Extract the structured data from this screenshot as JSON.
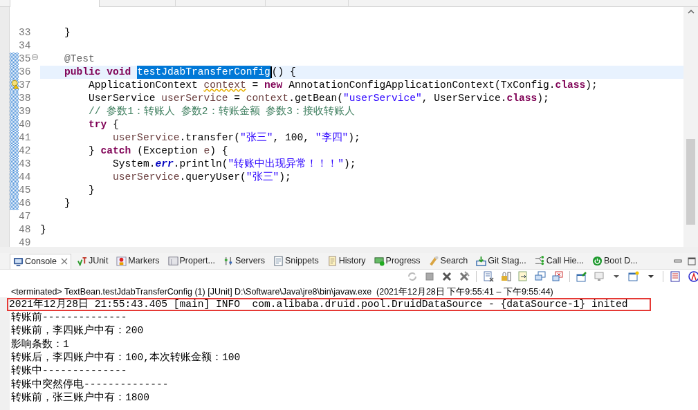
{
  "editor": {
    "lines": [
      {
        "number": "33",
        "changed": false,
        "current": false,
        "collapsible": false,
        "has_warning": false,
        "tokens": [
          {
            "kind": "plain",
            "text": "    }"
          }
        ]
      },
      {
        "number": "34",
        "changed": false,
        "current": false,
        "collapsible": false,
        "has_warning": false
      },
      {
        "number": "35",
        "changed": true,
        "current": false,
        "collapsible": true,
        "has_warning": false,
        "tokens": [
          {
            "kind": "annotation",
            "text": "    @Test"
          }
        ]
      },
      {
        "number": "36",
        "changed": true,
        "current": true,
        "collapsible": false,
        "has_warning": false,
        "tokens": [
          {
            "kind": "keyword",
            "text": "    public"
          },
          {
            "kind": "keyword",
            "text": " void"
          },
          {
            "kind": "selection",
            "text": " testJdabTransferConfig"
          },
          {
            "kind": "plain",
            "text": "() {"
          }
        ]
      },
      {
        "number": "37",
        "changed": true,
        "current": false,
        "collapsible": false,
        "has_warning": true,
        "tokens": [
          {
            "kind": "plain",
            "text": "        ApplicationContext"
          },
          {
            "kind": "warning",
            "text": " context"
          },
          {
            "kind": "plain",
            "text": " = "
          },
          {
            "kind": "keyword",
            "text": "new"
          },
          {
            "kind": "plain",
            "text": " AnnotationConfigApplicationContext(TxConfig."
          },
          {
            "kind": "keyword",
            "text": "class"
          },
          {
            "kind": "plain",
            "text": ");"
          }
        ]
      },
      {
        "number": "38",
        "changed": true,
        "current": false,
        "collapsible": false,
        "has_warning": false,
        "tokens": [
          {
            "kind": "plain",
            "text": "        UserService"
          },
          {
            "kind": "local",
            "text": " userService"
          },
          {
            "kind": "plain",
            "text": " = "
          },
          {
            "kind": "local",
            "text": "context"
          },
          {
            "kind": "plain",
            "text": ".getBean("
          },
          {
            "kind": "string",
            "text": "\"userService\""
          },
          {
            "kind": "plain",
            "text": ", UserService."
          },
          {
            "kind": "keyword",
            "text": "class"
          },
          {
            "kind": "plain",
            "text": ");"
          }
        ]
      },
      {
        "number": "39",
        "changed": true,
        "current": false,
        "collapsible": false,
        "has_warning": false,
        "tokens": [
          {
            "kind": "comment",
            "text": "        // 参数1：转账人 参数2：转账金额 参数3：接收转账人"
          }
        ]
      },
      {
        "number": "40",
        "changed": true,
        "current": false,
        "collapsible": false,
        "has_warning": false,
        "tokens": [
          {
            "kind": "keyword",
            "text": "        try"
          },
          {
            "kind": "plain",
            "text": " {"
          }
        ]
      },
      {
        "number": "41",
        "changed": true,
        "current": false,
        "collapsible": false,
        "has_warning": false,
        "tokens": [
          {
            "kind": "local",
            "text": "            userService"
          },
          {
            "kind": "plain",
            "text": ".transfer("
          },
          {
            "kind": "string",
            "text": "\"张三\""
          },
          {
            "kind": "plain",
            "text": ", 100, "
          },
          {
            "kind": "string",
            "text": "\"李四\""
          },
          {
            "kind": "plain",
            "text": ");"
          }
        ]
      },
      {
        "number": "42",
        "changed": true,
        "current": false,
        "collapsible": false,
        "has_warning": false,
        "tokens": [
          {
            "kind": "plain",
            "text": "        }"
          },
          {
            "kind": "keyword",
            "text": " catch"
          },
          {
            "kind": "plain",
            "text": " (Exception"
          },
          {
            "kind": "local",
            "text": " e"
          },
          {
            "kind": "plain",
            "text": ") {"
          }
        ]
      },
      {
        "number": "43",
        "changed": true,
        "current": false,
        "collapsible": false,
        "has_warning": false,
        "tokens": [
          {
            "kind": "plain",
            "text": "            System."
          },
          {
            "kind": "field",
            "text": "err"
          },
          {
            "kind": "plain",
            "text": ".println("
          },
          {
            "kind": "string",
            "text": "\"转账中出现异常！！！\""
          },
          {
            "kind": "plain",
            "text": ");"
          }
        ]
      },
      {
        "number": "44",
        "changed": true,
        "current": false,
        "collapsible": false,
        "has_warning": false,
        "tokens": [
          {
            "kind": "local",
            "text": "            userService"
          },
          {
            "kind": "plain",
            "text": ".queryUser("
          },
          {
            "kind": "string",
            "text": "\"张三\""
          },
          {
            "kind": "plain",
            "text": ");"
          }
        ]
      },
      {
        "number": "45",
        "changed": true,
        "current": false,
        "collapsible": false,
        "has_warning": false,
        "tokens": [
          {
            "kind": "plain",
            "text": "        }"
          }
        ]
      },
      {
        "number": "46",
        "changed": true,
        "current": false,
        "collapsible": false,
        "has_warning": false,
        "tokens": [
          {
            "kind": "plain",
            "text": "    }"
          }
        ]
      },
      {
        "number": "47",
        "changed": false,
        "current": false,
        "collapsible": false,
        "has_warning": false
      },
      {
        "number": "48",
        "changed": false,
        "current": false,
        "collapsible": false,
        "has_warning": false,
        "tokens": [
          {
            "kind": "plain",
            "text": "}"
          }
        ]
      },
      {
        "number": "49",
        "changed": false,
        "current": false,
        "collapsible": false,
        "has_warning": false
      }
    ]
  },
  "console": {
    "tabs": [
      {
        "label": "Console",
        "selected": true,
        "closable": true
      },
      {
        "label": "JUnit",
        "selected": false,
        "closable": false
      },
      {
        "label": "Markers",
        "selected": false,
        "closable": false
      },
      {
        "label": "Propert...",
        "selected": false,
        "closable": false
      },
      {
        "label": "Servers",
        "selected": false,
        "closable": false
      },
      {
        "label": "Snippets",
        "selected": false,
        "closable": false
      },
      {
        "label": "History",
        "selected": false,
        "closable": false
      },
      {
        "label": "Progress",
        "selected": false,
        "closable": false
      },
      {
        "label": "Search",
        "selected": false,
        "closable": false
      },
      {
        "label": "Git Stag...",
        "selected": false,
        "closable": false
      },
      {
        "label": "Call Hie...",
        "selected": false,
        "closable": false
      },
      {
        "label": "Boot D...",
        "selected": false,
        "closable": false
      }
    ],
    "status": "<terminated> TextBean.testJdabTransferConfig (1) [JUnit] D:\\Software\\Java\\jre8\\bin\\javaw.exe  (2021年12月28日 下午9:55:41 – 下午9:55:44)",
    "output": [
      {
        "text": "2021年12月28日 21:55:43.405 [main] INFO  com.alibaba.druid.pool.DruidDataSource - {dataSource-1} inited",
        "highlighted": true
      },
      {
        "text": "转账前--------------",
        "highlighted": false
      },
      {
        "text": "转账前，李四账户中有：200",
        "highlighted": false
      },
      {
        "text": "影响条数：1",
        "highlighted": false
      },
      {
        "text": "转账后，李四账户中有：100,本次转账金额：100",
        "highlighted": false
      },
      {
        "text": "转账中--------------",
        "highlighted": false
      },
      {
        "text": "转账中突然停电--------------",
        "highlighted": false
      },
      {
        "text": "转账前，张三账户中有：1800",
        "highlighted": false
      }
    ]
  }
}
